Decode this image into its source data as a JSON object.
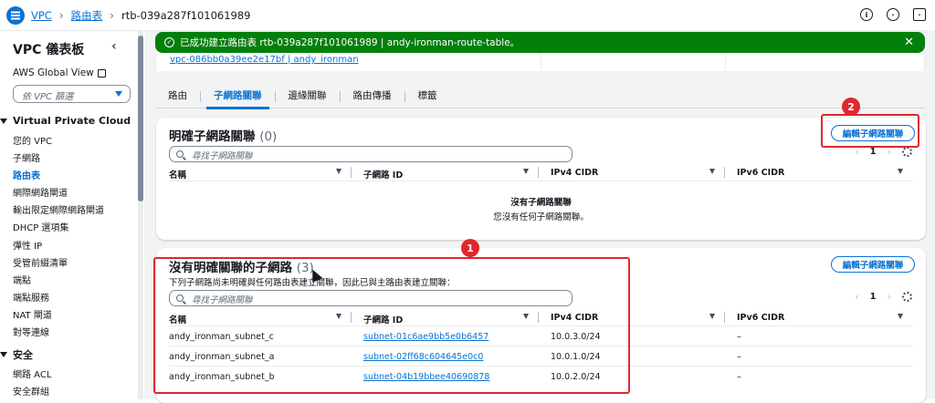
{
  "breadcrumb": {
    "root": "VPC",
    "section": "路由表",
    "current": "rtb-039a287f101061989"
  },
  "sidebar": {
    "title": "VPC 儀表板",
    "global_view": "AWS Global View",
    "filter_placeholder": "依 VPC 篩選",
    "section_vpc": "Virtual Private Cloud",
    "items": [
      "您的 VPC",
      "子網路",
      "路由表",
      "網際網路閘道",
      "輸出限定網際網路閘道",
      "DHCP 選項集",
      "彈性 IP",
      "受管前綴清單",
      "端點",
      "端點服務",
      "NAT 閘道",
      "對等連線"
    ],
    "active_item": "路由表",
    "section_security": "安全",
    "security_items": [
      "網路 ACL",
      "安全群組"
    ]
  },
  "flash": {
    "message": "已成功建立路由表 rtb-039a287f101061989 | andy-ironman-route-table。"
  },
  "summary": {
    "vpc_link": "vpc-086bb0a39ee2e17bf | andy_ironman"
  },
  "tabs": [
    "路由",
    "子網路關聯",
    "邊緣關聯",
    "路由傳播",
    "標籤"
  ],
  "active_tab": "子網路關聯",
  "explicit": {
    "title": "明確子網路關聯",
    "count": "(0)",
    "edit_label": "編輯子網路關聯",
    "search_placeholder": "尋找子網路關聯",
    "page": "1",
    "columns": [
      "名稱",
      "子網路 ID",
      "IPv4 CIDR",
      "IPv6 CIDR"
    ],
    "empty_title": "沒有子網路關聯",
    "empty_desc": "您沒有任何子網路關聯。"
  },
  "implicit": {
    "title": "沒有明確關聯的子網路",
    "count": "(3)",
    "desc": "下列子網路尚未明確與任何路由表建立關聯，因此已與主路由表建立關聯：",
    "edit_label": "編輯子網路關聯",
    "search_placeholder": "尋找子網路關聯",
    "page": "1",
    "columns": [
      "名稱",
      "子網路 ID",
      "IPv4 CIDR",
      "IPv6 CIDR"
    ],
    "rows": [
      {
        "name": "andy_ironman_subnet_c",
        "subnet": "subnet-01c6ae9bb5e0b6457",
        "ipv4": "10.0.3.0/24",
        "ipv6": "–"
      },
      {
        "name": "andy_ironman_subnet_a",
        "subnet": "subnet-02ff68c604645e0c0",
        "ipv4": "10.0.1.0/24",
        "ipv6": "–"
      },
      {
        "name": "andy_ironman_subnet_b",
        "subnet": "subnet-04b19bbee40690878",
        "ipv4": "10.0.2.0/24",
        "ipv6": "–"
      }
    ]
  },
  "annotations": {
    "one": "1",
    "two": "2"
  },
  "colors": {
    "accent": "#0972d3",
    "success": "#037f0c",
    "annotation": "#e0282e"
  }
}
